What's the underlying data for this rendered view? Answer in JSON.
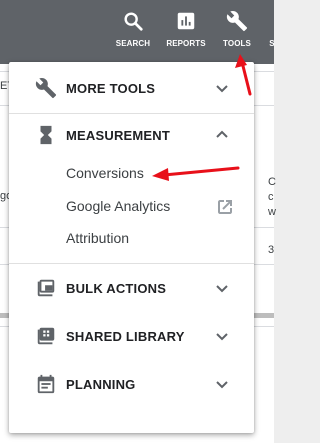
{
  "topbar": {
    "search_label": "SEARCH",
    "reports_label": "REPORTS",
    "tools_label": "TOOLS",
    "partial_label": "S"
  },
  "background": {
    "text_left_1": "ET",
    "text_left_2": "go",
    "text_right_1": "C",
    "text_right_2": "c",
    "text_right_3": "w",
    "text_right_4": "3"
  },
  "menu": {
    "more_tools": "MORE TOOLS",
    "measurement": "MEASUREMENT",
    "measurement_items": [
      "Conversions",
      "Google Analytics",
      "Attribution"
    ],
    "bulk_actions": "BULK ACTIONS",
    "shared_library": "SHARED LIBRARY",
    "planning": "PLANNING"
  },
  "colors": {
    "topbar": "#5f6368",
    "annotation_arrow": "#e8101a",
    "icon_gray": "#5f6368"
  }
}
